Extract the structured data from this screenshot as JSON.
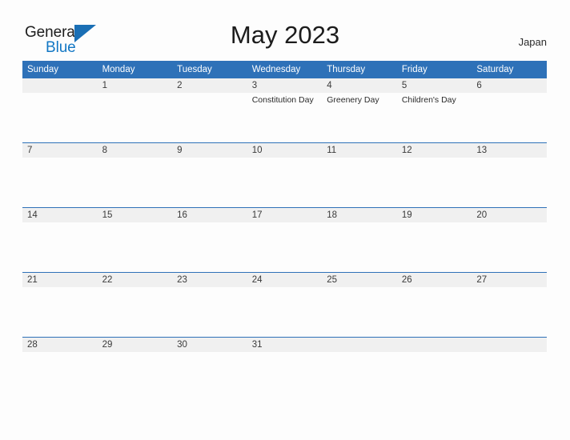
{
  "brand": {
    "word_one": "General",
    "word_two": "Blue",
    "triangle_icon": "triangle-icon",
    "color_dark": "#1c1c1c",
    "color_blue": "#1277c4"
  },
  "header": {
    "title": "May 2023",
    "region": "Japan"
  },
  "colors": {
    "header_blue": "#2e71b8",
    "band_gray": "#f0f0f0",
    "page_bg": "#fdfdfd",
    "text_dark": "#3a3a3a"
  },
  "calendar": {
    "weekdays": [
      "Sunday",
      "Monday",
      "Tuesday",
      "Wednesday",
      "Thursday",
      "Friday",
      "Saturday"
    ],
    "weeks": [
      {
        "days": [
          {
            "num": "",
            "event": ""
          },
          {
            "num": "1",
            "event": ""
          },
          {
            "num": "2",
            "event": ""
          },
          {
            "num": "3",
            "event": "Constitution Day"
          },
          {
            "num": "4",
            "event": "Greenery Day"
          },
          {
            "num": "5",
            "event": "Children's Day"
          },
          {
            "num": "6",
            "event": ""
          }
        ]
      },
      {
        "days": [
          {
            "num": "7",
            "event": ""
          },
          {
            "num": "8",
            "event": ""
          },
          {
            "num": "9",
            "event": ""
          },
          {
            "num": "10",
            "event": ""
          },
          {
            "num": "11",
            "event": ""
          },
          {
            "num": "12",
            "event": ""
          },
          {
            "num": "13",
            "event": ""
          }
        ]
      },
      {
        "days": [
          {
            "num": "14",
            "event": ""
          },
          {
            "num": "15",
            "event": ""
          },
          {
            "num": "16",
            "event": ""
          },
          {
            "num": "17",
            "event": ""
          },
          {
            "num": "18",
            "event": ""
          },
          {
            "num": "19",
            "event": ""
          },
          {
            "num": "20",
            "event": ""
          }
        ]
      },
      {
        "days": [
          {
            "num": "21",
            "event": ""
          },
          {
            "num": "22",
            "event": ""
          },
          {
            "num": "23",
            "event": ""
          },
          {
            "num": "24",
            "event": ""
          },
          {
            "num": "25",
            "event": ""
          },
          {
            "num": "26",
            "event": ""
          },
          {
            "num": "27",
            "event": ""
          }
        ]
      },
      {
        "days": [
          {
            "num": "28",
            "event": ""
          },
          {
            "num": "29",
            "event": ""
          },
          {
            "num": "30",
            "event": ""
          },
          {
            "num": "31",
            "event": ""
          },
          {
            "num": "",
            "event": ""
          },
          {
            "num": "",
            "event": ""
          },
          {
            "num": "",
            "event": ""
          }
        ]
      }
    ]
  }
}
